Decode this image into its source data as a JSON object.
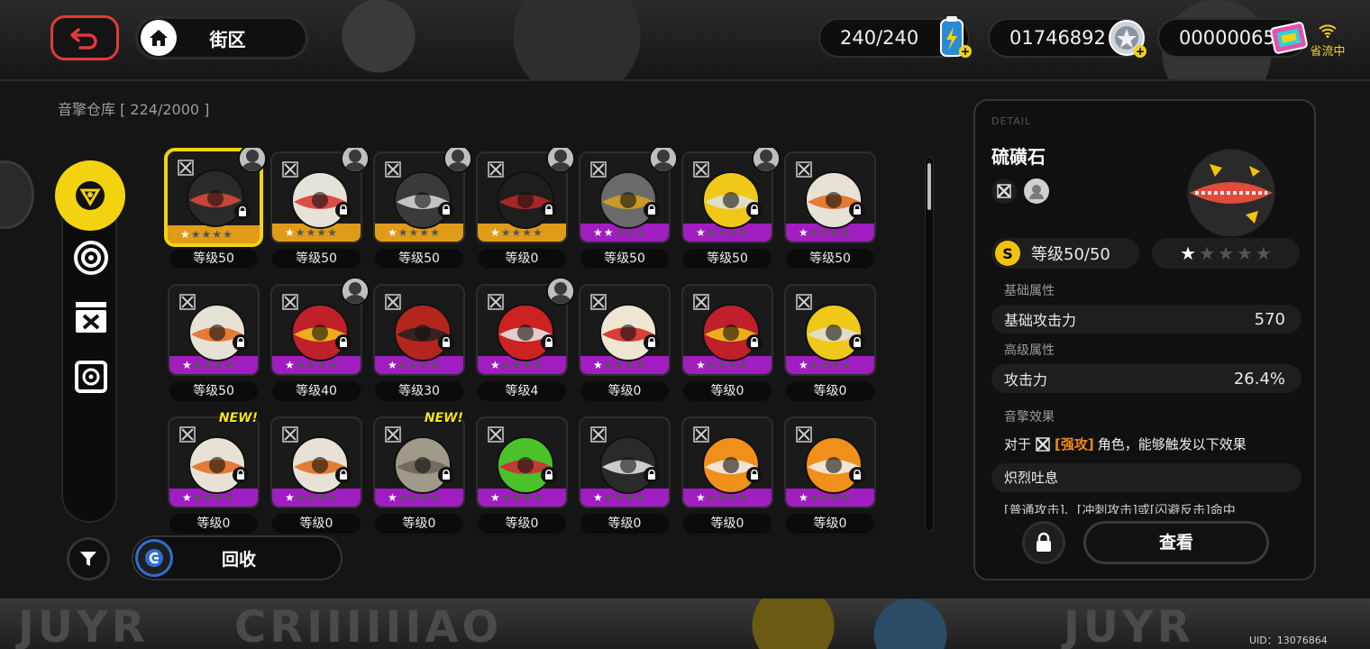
{
  "topbar": {
    "location": "街区",
    "battery": "240/240",
    "currency": "01746892",
    "film": "00000065",
    "stream_status": "省流中"
  },
  "inventory": {
    "title": "音擎仓库 [ 224/2000 ]",
    "recycle_label": "回收",
    "categories": [
      "engine-icon",
      "disc-icon",
      "bangboo-icon",
      "drive-icon"
    ],
    "items": [
      {
        "level": "等级50",
        "rarity": "A",
        "stars": 1,
        "selected": true,
        "avatar": true,
        "new": false,
        "color": "#2a2a2a",
        "accent": "#e24a3a"
      },
      {
        "level": "等级50",
        "rarity": "A",
        "stars": 1,
        "selected": false,
        "avatar": true,
        "new": false,
        "color": "#e6e2da",
        "accent": "#d8342a"
      },
      {
        "level": "等级50",
        "rarity": "A",
        "stars": 1,
        "selected": false,
        "avatar": true,
        "new": false,
        "color": "#3a3a3a",
        "accent": "#dcdcdc"
      },
      {
        "level": "等级0",
        "rarity": "A",
        "stars": 1,
        "selected": false,
        "avatar": true,
        "new": false,
        "color": "#1e1e1e",
        "accent": "#c22828"
      },
      {
        "level": "等级50",
        "rarity": "B",
        "stars": 2,
        "selected": false,
        "avatar": true,
        "new": false,
        "color": "#6a6a6a",
        "accent": "#d9a21c"
      },
      {
        "level": "等级50",
        "rarity": "B",
        "stars": 1,
        "selected": false,
        "avatar": true,
        "new": false,
        "color": "#f0c818",
        "accent": "#e0e0e0"
      },
      {
        "level": "等级50",
        "rarity": "B",
        "stars": 1,
        "selected": false,
        "avatar": false,
        "new": false,
        "color": "#e8e2d6",
        "accent": "#e36a1c"
      },
      {
        "level": "等级50",
        "rarity": "B",
        "stars": 1,
        "selected": false,
        "avatar": false,
        "new": false,
        "color": "#e8e2d6",
        "accent": "#e36a1c"
      },
      {
        "level": "等级40",
        "rarity": "B",
        "stars": 1,
        "selected": false,
        "avatar": true,
        "new": false,
        "color": "#c0202a",
        "accent": "#f3c81a"
      },
      {
        "level": "等级30",
        "rarity": "B",
        "stars": 1,
        "selected": false,
        "avatar": false,
        "new": false,
        "color": "#b3261e",
        "accent": "#222222"
      },
      {
        "level": "等级4",
        "rarity": "B",
        "stars": 1,
        "selected": false,
        "avatar": true,
        "new": false,
        "color": "#cc2222",
        "accent": "#eaeaea"
      },
      {
        "level": "等级0",
        "rarity": "B",
        "stars": 1,
        "selected": false,
        "avatar": false,
        "new": false,
        "color": "#eee6d0",
        "accent": "#d42020"
      },
      {
        "level": "等级0",
        "rarity": "B",
        "stars": 1,
        "selected": false,
        "avatar": false,
        "new": false,
        "color": "#c0202a",
        "accent": "#f3c81a"
      },
      {
        "level": "等级0",
        "rarity": "B",
        "stars": 1,
        "selected": false,
        "avatar": false,
        "new": false,
        "color": "#f0c818",
        "accent": "#e0e0e0"
      },
      {
        "level": "等级0",
        "rarity": "B",
        "stars": 1,
        "selected": false,
        "avatar": false,
        "new": true,
        "color": "#e8e2d6",
        "accent": "#e36a1c"
      },
      {
        "level": "等级0",
        "rarity": "B",
        "stars": 1,
        "selected": false,
        "avatar": false,
        "new": false,
        "color": "#e8e2d6",
        "accent": "#e36a1c"
      },
      {
        "level": "等级0",
        "rarity": "B",
        "stars": 1,
        "selected": false,
        "avatar": false,
        "new": true,
        "color": "#a09a88",
        "accent": "#6a6456"
      },
      {
        "level": "等级0",
        "rarity": "B",
        "stars": 1,
        "selected": false,
        "avatar": false,
        "new": false,
        "color": "#4cc22a",
        "accent": "#d6243a"
      },
      {
        "level": "等级0",
        "rarity": "B",
        "stars": 1,
        "selected": false,
        "avatar": false,
        "new": false,
        "color": "#2a2a2a",
        "accent": "#e8e8e8"
      },
      {
        "level": "等级0",
        "rarity": "B",
        "stars": 1,
        "selected": false,
        "avatar": false,
        "new": false,
        "color": "#f0901a",
        "accent": "#f2f2f2"
      },
      {
        "level": "等级0",
        "rarity": "B",
        "stars": 1,
        "selected": false,
        "avatar": false,
        "new": false,
        "color": "#f0901a",
        "accent": "#f2f2f2"
      }
    ],
    "new_label": "NEW!"
  },
  "detail": {
    "caption": "DETAIL",
    "name": "硫磺石",
    "level": "等级50/50",
    "stars": 1,
    "basic_attr_label": "基础属性",
    "basic_stat_name": "基础攻击力",
    "basic_stat_value": "570",
    "adv_attr_label": "高级属性",
    "adv_stat_name": "攻击力",
    "adv_stat_value": "26.4%",
    "effect_label": "音擎效果",
    "effect_prefix": "对于",
    "effect_type": "[强攻]",
    "effect_suffix": "角色，能够触发以下效果",
    "effect_name": "炽烈吐息",
    "effect_desc": "[普通攻击]、[冲刺攻击]或[闪避反击]命中",
    "view_label": "查看"
  },
  "uid": "UID：13076864",
  "colors": {
    "accent_yellow": "#f3d20f",
    "rarity_a": "#e09c18",
    "rarity_b": "#a01dbf",
    "back_red": "#e23a3a"
  }
}
